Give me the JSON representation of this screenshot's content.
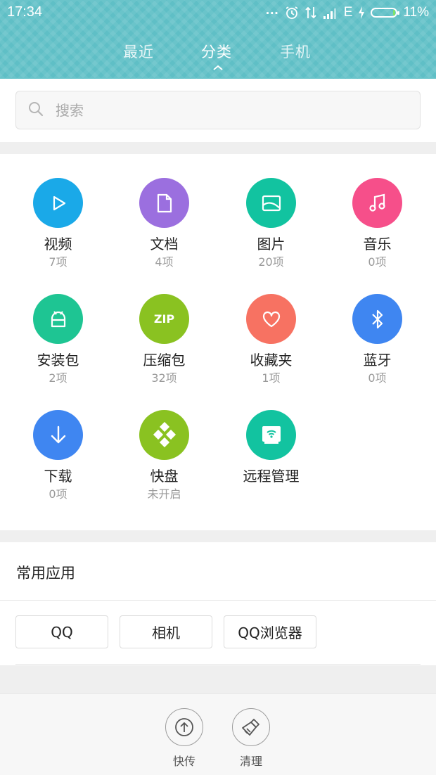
{
  "status_bar": {
    "time": "17:34",
    "dots": "...",
    "network": "E",
    "battery": "11%",
    "battery_level": 0.11
  },
  "tabs": [
    {
      "label": "最近",
      "active": false
    },
    {
      "label": "分类",
      "active": true
    },
    {
      "label": "手机",
      "active": false
    }
  ],
  "search": {
    "placeholder": "搜索",
    "value": ""
  },
  "categories": [
    {
      "name": "视频",
      "count": "7项",
      "color": "#1aa9e8",
      "icon": "play-icon"
    },
    {
      "name": "文档",
      "count": "4项",
      "color": "#9b6fdf",
      "icon": "document-icon"
    },
    {
      "name": "图片",
      "count": "20项",
      "color": "#12c3a0",
      "icon": "image-icon"
    },
    {
      "name": "音乐",
      "count": "0项",
      "color": "#f64f8a",
      "icon": "music-icon"
    },
    {
      "name": "安装包",
      "count": "2项",
      "color": "#1ec593",
      "icon": "android-icon"
    },
    {
      "name": "压缩包",
      "count": "32项",
      "color": "#8ac221",
      "icon": "zip-icon",
      "icon_text": "ZIP"
    },
    {
      "name": "收藏夹",
      "count": "1项",
      "color": "#f77262",
      "icon": "heart-icon"
    },
    {
      "name": "蓝牙",
      "count": "0项",
      "color": "#3f86f1",
      "icon": "bluetooth-icon"
    },
    {
      "name": "下载",
      "count": "0项",
      "color": "#3f86f1",
      "icon": "download-icon"
    },
    {
      "name": "快盘",
      "count": "未开启",
      "color": "#8ac221",
      "icon": "kuaipan-icon"
    },
    {
      "name": "远程管理",
      "count": "",
      "color": "#12c3a0",
      "icon": "remote-wifi-icon"
    }
  ],
  "frequent_apps": {
    "title": "常用应用",
    "apps": [
      "QQ",
      "相机",
      "QQ浏览器"
    ]
  },
  "bottom_bar": [
    {
      "label": "快传",
      "icon": "upload-icon"
    },
    {
      "label": "清理",
      "icon": "broom-icon"
    }
  ]
}
